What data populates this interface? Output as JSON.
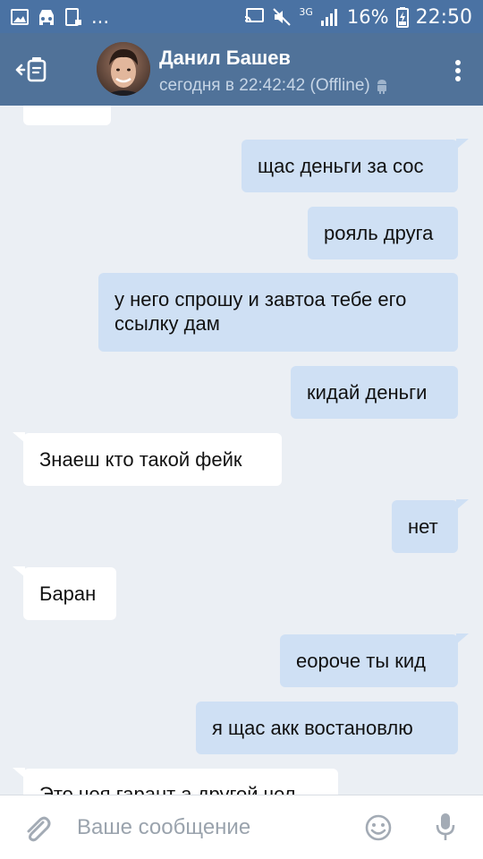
{
  "statusbar": {
    "left_icons": [
      "gallery-icon",
      "car-mode-icon",
      "tablet-icon"
    ],
    "overflow": "...",
    "right_icons": [
      "cast-icon",
      "mute-icon",
      "network-3g-icon",
      "signal-icon"
    ],
    "network": "3G",
    "battery": "16%",
    "time": "22:50"
  },
  "header": {
    "name": "Данил Башев",
    "status": "сегодня в 22:42:42 (Offline)",
    "platform_icon": "android-icon",
    "back_icon": "back-arrow-icon",
    "menu_icon": "more-vertical-icon"
  },
  "messages": [
    {
      "dir": "in",
      "text": ""
    },
    {
      "dir": "out",
      "text": "щас деньги за сос"
    },
    {
      "dir": "out",
      "text": "рояль друга"
    },
    {
      "dir": "out",
      "text": "у него спрошу и завтоа тебе его ссылку дам"
    },
    {
      "dir": "out",
      "text": "кидай деньги"
    },
    {
      "dir": "in",
      "text": "Знаеш кто такой фейк"
    },
    {
      "dir": "out",
      "text": "нет"
    },
    {
      "dir": "in",
      "text": "Баран"
    },
    {
      "dir": "out",
      "text": "еороче ты кид"
    },
    {
      "dir": "out",
      "text": "я щас акк востановлю"
    },
    {
      "dir": "in",
      "text": "Это чея гарант а другой чел"
    }
  ],
  "composer": {
    "placeholder": "Ваше сообщение",
    "attach_icon": "paperclip-icon",
    "emoji_icon": "smiley-icon",
    "mic_icon": "microphone-icon"
  },
  "colors": {
    "statusbar": "#4a72a3",
    "header": "#507299",
    "chat_bg": "#ebeff4",
    "outgoing_bubble": "#cfe0f4",
    "incoming_bubble": "#ffffff",
    "status_text": "#c6d5e6"
  }
}
